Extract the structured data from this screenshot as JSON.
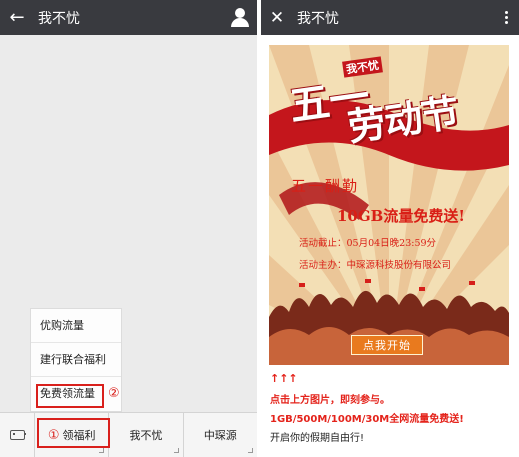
{
  "left_screen": {
    "header": {
      "title": "我不忧",
      "back_icon": "back-arrow-icon",
      "profile_icon": "user-icon"
    },
    "popup_menu": {
      "items": [
        "优购流量",
        "建行联合福利",
        "免费领流量"
      ],
      "highlighted_index": 2,
      "marker": "②"
    },
    "bottom_menu": {
      "keyboard_icon": "keyboard-icon",
      "tabs": [
        {
          "label": "领福利",
          "marker": "①"
        },
        {
          "label": "我不忧"
        },
        {
          "label": "中琛源"
        }
      ]
    }
  },
  "right_screen": {
    "header": {
      "title": "我不忧",
      "close_icon": "close-icon",
      "more_icon": "more-dots-icon"
    },
    "poster": {
      "brand": "我不忧",
      "headline_1": "五一",
      "headline_2": "劳动节",
      "subtitle": "五一酬勤",
      "offer": "10GB流量免费送!",
      "deadline": "活动截止：05月04日晚23:59分",
      "organizer": "活动主办：中琛源科技股份有限公司",
      "button_label": "点我开始"
    },
    "messages": {
      "arrows": "↑↑↑",
      "line1": "点击上方图片，即刻参与。",
      "line2": "1GB/500M/100M/30M全网流量免费送!",
      "line3": "开启你的假期自由行!"
    }
  },
  "colors": {
    "topbar": "#393a3f",
    "highlight_red": "#d9201c",
    "poster_red": "#c4161c",
    "button_orange": "#e97a1e"
  }
}
